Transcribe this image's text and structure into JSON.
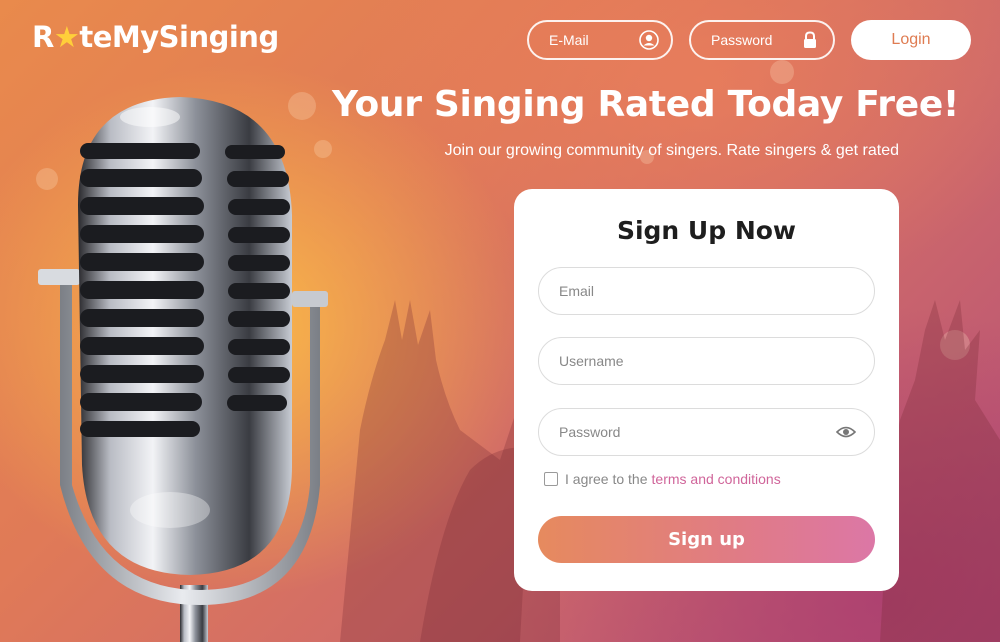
{
  "brand": {
    "name_prefix": "R",
    "name_star": "★",
    "name_suffix": "teMySinging"
  },
  "header": {
    "email_placeholder": "E-Mail",
    "password_placeholder": "Password",
    "login_label": "Login",
    "user_icon": "user-circle-icon",
    "lock_icon": "lock-icon"
  },
  "hero": {
    "headline": "Your Singing Rated Today Free!",
    "subline": "Join our growing community of singers. Rate singers & get rated"
  },
  "signup": {
    "title": "Sign Up Now",
    "email_placeholder": "Email",
    "username_placeholder": "Username",
    "password_placeholder": "Password",
    "eye_icon": "eye-icon",
    "agree_text": "I agree to the",
    "terms_link": "terms and conditions",
    "button_label": "Sign up"
  },
  "colors": {
    "accent": "#df7c52",
    "link": "#d0659a",
    "button_gradient_start": "#e68a5e",
    "button_gradient_end": "#dc77a6"
  }
}
